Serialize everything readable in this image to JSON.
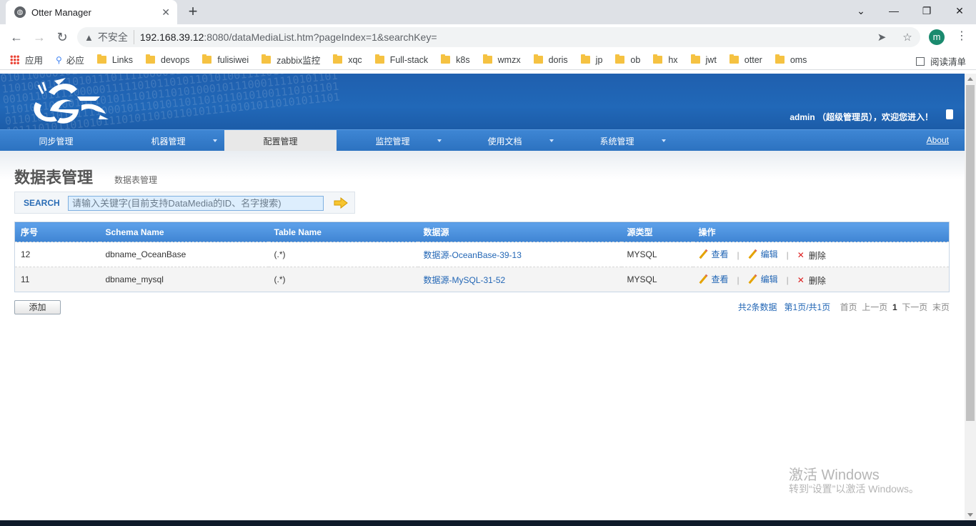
{
  "browser": {
    "tab_title": "Otter Manager",
    "tab_close": "✕",
    "new_tab": "+",
    "insecure_label": "不安全",
    "url_host": "192.168.39.12",
    "url_rest": ":8080/dataMediaList.htm?pageIndex=1&searchKey=",
    "profile_initial": "m",
    "bookmarks": [
      {
        "label": "应用",
        "icon": "apps-icon"
      },
      {
        "label": "必应",
        "icon": "search-icon"
      },
      {
        "label": "Links",
        "icon": "folder-icon"
      },
      {
        "label": "devops",
        "icon": "folder-icon"
      },
      {
        "label": "fulisiwei",
        "icon": "folder-icon"
      },
      {
        "label": "zabbix监控",
        "icon": "folder-icon"
      },
      {
        "label": "xqc",
        "icon": "folder-icon"
      },
      {
        "label": "Full-stack",
        "icon": "folder-icon"
      },
      {
        "label": "k8s",
        "icon": "folder-icon"
      },
      {
        "label": "wmzx",
        "icon": "folder-icon"
      },
      {
        "label": "doris",
        "icon": "folder-icon"
      },
      {
        "label": "jp",
        "icon": "folder-icon"
      },
      {
        "label": "ob",
        "icon": "folder-icon"
      },
      {
        "label": "hx",
        "icon": "folder-icon"
      },
      {
        "label": "jwt",
        "icon": "folder-icon"
      },
      {
        "label": "otter",
        "icon": "folder-icon"
      },
      {
        "label": "oms",
        "icon": "folder-icon"
      }
    ],
    "reading_list": "阅读清单"
  },
  "header": {
    "user_info": "admin （超级管理员），欢迎您进入！"
  },
  "nav": {
    "items": [
      {
        "label": "同步管理",
        "dropdown": false,
        "active": false
      },
      {
        "label": "机器管理",
        "dropdown": true,
        "active": false
      },
      {
        "label": "配置管理",
        "dropdown": false,
        "active": true
      },
      {
        "label": "监控管理",
        "dropdown": true,
        "active": false
      },
      {
        "label": "使用文档",
        "dropdown": true,
        "active": false
      },
      {
        "label": "系统管理",
        "dropdown": true,
        "active": false
      }
    ],
    "about": "About"
  },
  "main": {
    "title": "数据表管理",
    "breadcrumb": "数据表管理",
    "search_label": "SEARCH",
    "search_placeholder": "请输入关键字(目前支持DataMedia的ID、名字搜索)",
    "search_value": ""
  },
  "table": {
    "columns": [
      "序号",
      "Schema Name",
      "Table Name",
      "数据源",
      "源类型",
      "操作"
    ],
    "rows": [
      {
        "id": "12",
        "schema": "dbname_OceanBase",
        "table": "(.*)",
        "source": "数据源-OceanBase-39-13",
        "type": "MYSQL"
      },
      {
        "id": "11",
        "schema": "dbname_mysql",
        "table": "(.*)",
        "source": "数据源-MySQL-31-52",
        "type": "MYSQL"
      }
    ],
    "actions": {
      "view": "查看",
      "edit": "编辑",
      "delete": "删除",
      "separator": "|"
    }
  },
  "footer": {
    "add_button": "添加",
    "total": "共2条数据",
    "page_info": "第1页/共1页",
    "first": "首页",
    "prev": "上一页",
    "current": "1",
    "next": "下一页",
    "last": "末页"
  },
  "watermark": {
    "line1": "激活 Windows",
    "line2": "转到“设置”以激活 Windows。"
  },
  "colors": {
    "header_blue": "#1f5fae",
    "nav_blue": "#3e86d4",
    "link_blue": "#2266b5",
    "delete_red": "#dd2222"
  }
}
